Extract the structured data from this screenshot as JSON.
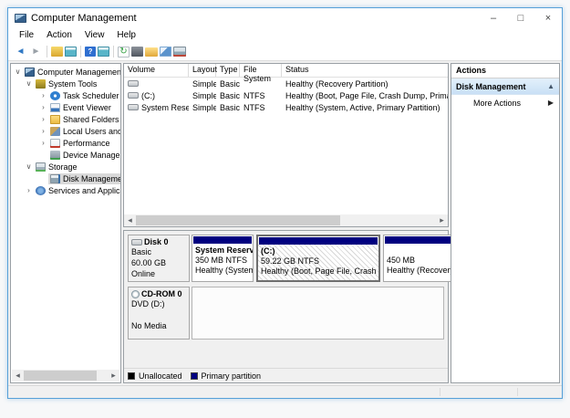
{
  "window": {
    "title": "Computer Management",
    "controls": {
      "minimize": "–",
      "maximize": "□",
      "close": "×"
    }
  },
  "menu": {
    "items": [
      "File",
      "Action",
      "View",
      "Help"
    ]
  },
  "toolbar": {
    "icons": [
      {
        "name": "back-icon",
        "glyph": "◄"
      },
      {
        "name": "forward-icon",
        "glyph": "►"
      },
      {
        "name": "show-console-tree-icon",
        "glyph": ""
      },
      {
        "name": "show-action-pane-icon",
        "glyph": ""
      },
      {
        "name": "help-icon",
        "glyph": "?"
      },
      {
        "name": "window-icon",
        "glyph": ""
      },
      {
        "name": "refresh-icon",
        "glyph": "↻"
      },
      {
        "name": "properties-icon",
        "glyph": ""
      },
      {
        "name": "open-folder-icon",
        "glyph": ""
      },
      {
        "name": "find-icon",
        "glyph": ""
      },
      {
        "name": "disk-tool-icon",
        "glyph": ""
      }
    ]
  },
  "tree": {
    "items": [
      {
        "label": "Computer Management (Local",
        "expander": "∨",
        "level": 0,
        "selected": false
      },
      {
        "label": "System Tools",
        "expander": "∨",
        "level": 1,
        "selected": false
      },
      {
        "label": "Task Scheduler",
        "expander": "›",
        "level": 2,
        "selected": false
      },
      {
        "label": "Event Viewer",
        "expander": "›",
        "level": 2,
        "selected": false
      },
      {
        "label": "Shared Folders",
        "expander": "›",
        "level": 2,
        "selected": false
      },
      {
        "label": "Local Users and Groups",
        "expander": "›",
        "level": 2,
        "selected": false
      },
      {
        "label": "Performance",
        "expander": "›",
        "level": 2,
        "selected": false
      },
      {
        "label": "Device Manager",
        "expander": "",
        "level": 2,
        "selected": false
      },
      {
        "label": "Storage",
        "expander": "∨",
        "level": 1,
        "selected": false
      },
      {
        "label": "Disk Management",
        "expander": "",
        "level": 2,
        "selected": true
      },
      {
        "label": "Services and Applications",
        "expander": "›",
        "level": 1,
        "selected": false
      }
    ]
  },
  "volume_list": {
    "columns": [
      "Volume",
      "Layout",
      "Type",
      "File System",
      "Status"
    ],
    "rows": [
      {
        "volume": "",
        "layout": "Simple",
        "type": "Basic",
        "fs": "",
        "status": "Healthy (Recovery Partition)"
      },
      {
        "volume": "(C:)",
        "layout": "Simple",
        "type": "Basic",
        "fs": "NTFS",
        "status": "Healthy (Boot, Page File, Crash Dump, Primary Partition)"
      },
      {
        "volume": "System Reserved",
        "layout": "Simple",
        "type": "Basic",
        "fs": "NTFS",
        "status": "Healthy (System, Active, Primary Partition)"
      }
    ]
  },
  "disks": {
    "disk0": {
      "title": "Disk 0",
      "lines": [
        "Basic",
        "60.00 GB",
        "Online"
      ],
      "partitions": [
        {
          "name": "System Reserved",
          "size": "350 MB NTFS",
          "status": "Healthy (System, Ac",
          "selected": false
        },
        {
          "name": "(C:)",
          "size": "59.22 GB NTFS",
          "status": "Healthy (Boot, Page File, Crash Dump, Pi",
          "selected": true
        },
        {
          "name": "",
          "size": "450 MB",
          "status": "Healthy (Recovery Pa",
          "selected": false
        }
      ]
    },
    "cdrom0": {
      "title": "CD-ROM 0",
      "media": "DVD (D:)",
      "status": "No Media"
    }
  },
  "legend": {
    "items": [
      {
        "label": "Unallocated",
        "color": "#000000"
      },
      {
        "label": "Primary partition",
        "color": "#00007f"
      }
    ]
  },
  "actions": {
    "header": "Actions",
    "group": "Disk Management",
    "group_arrow": "▲",
    "more": "More Actions",
    "more_arrow": "▶"
  },
  "colors": {
    "primary_partition": "#00007f",
    "window_border": "#56a0d8",
    "tree_selection": "#d9d9d9"
  },
  "scrollbar": {
    "left_arrow": "◂",
    "right_arrow": "▸"
  }
}
